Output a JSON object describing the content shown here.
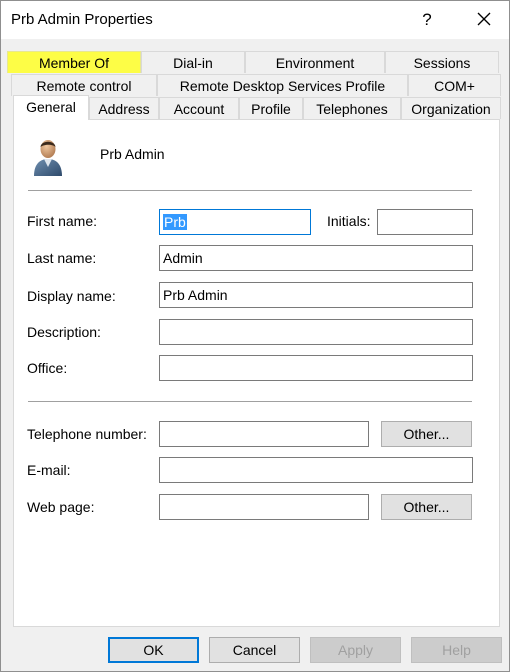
{
  "window": {
    "title": "Prb Admin Properties",
    "help_label": "?",
    "close_icon": "close-icon"
  },
  "tabs": {
    "row1": [
      "Member Of",
      "Dial-in",
      "Environment",
      "Sessions"
    ],
    "row2": [
      "Remote control",
      "Remote Desktop Services Profile",
      "COM+"
    ],
    "row3": [
      "General",
      "Address",
      "Account",
      "Profile",
      "Telephones",
      "Organization"
    ],
    "active": "General",
    "highlighted": "Member Of",
    "highlight_color": "#fdfd46"
  },
  "general": {
    "user_icon": "user-icon",
    "display_header": "Prb Admin",
    "first_name_label": "First name:",
    "first_name_value": "Prb",
    "initials_label": "Initials:",
    "initials_value": "",
    "last_name_label": "Last name:",
    "last_name_value": "Admin",
    "display_name_label": "Display name:",
    "display_name_value": "Prb Admin",
    "description_label": "Description:",
    "description_value": "",
    "office_label": "Office:",
    "office_value": "",
    "telephone_label": "Telephone number:",
    "telephone_value": "",
    "telephone_other_label": "Other...",
    "email_label": "E-mail:",
    "email_value": "",
    "webpage_label": "Web page:",
    "webpage_value": "",
    "webpage_other_label": "Other..."
  },
  "buttons": {
    "ok": "OK",
    "cancel": "Cancel",
    "apply": "Apply",
    "help": "Help"
  },
  "colors": {
    "accent": "#0078d7",
    "selection": "#3399ff"
  }
}
